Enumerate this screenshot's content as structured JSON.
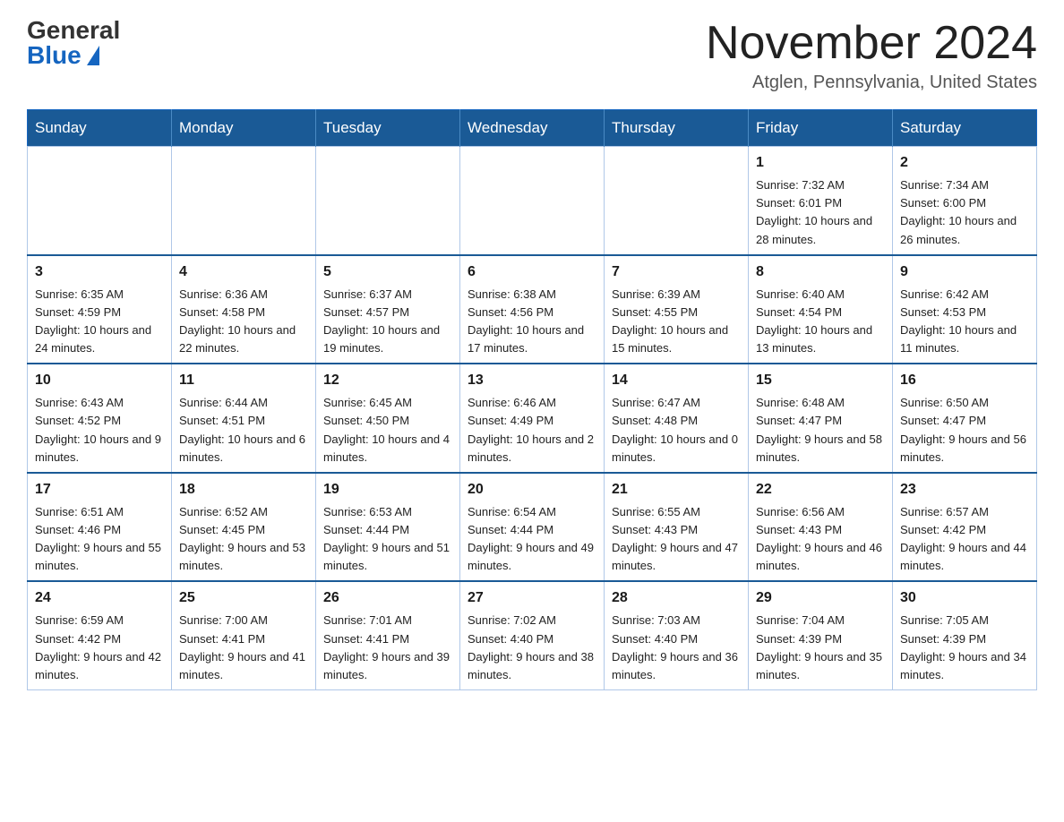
{
  "header": {
    "logo_general": "General",
    "logo_blue": "Blue",
    "month_title": "November 2024",
    "location": "Atglen, Pennsylvania, United States"
  },
  "days_of_week": [
    "Sunday",
    "Monday",
    "Tuesday",
    "Wednesday",
    "Thursday",
    "Friday",
    "Saturday"
  ],
  "weeks": [
    [
      {
        "day": "",
        "info": ""
      },
      {
        "day": "",
        "info": ""
      },
      {
        "day": "",
        "info": ""
      },
      {
        "day": "",
        "info": ""
      },
      {
        "day": "",
        "info": ""
      },
      {
        "day": "1",
        "info": "Sunrise: 7:32 AM\nSunset: 6:01 PM\nDaylight: 10 hours and 28 minutes."
      },
      {
        "day": "2",
        "info": "Sunrise: 7:34 AM\nSunset: 6:00 PM\nDaylight: 10 hours and 26 minutes."
      }
    ],
    [
      {
        "day": "3",
        "info": "Sunrise: 6:35 AM\nSunset: 4:59 PM\nDaylight: 10 hours and 24 minutes."
      },
      {
        "day": "4",
        "info": "Sunrise: 6:36 AM\nSunset: 4:58 PM\nDaylight: 10 hours and 22 minutes."
      },
      {
        "day": "5",
        "info": "Sunrise: 6:37 AM\nSunset: 4:57 PM\nDaylight: 10 hours and 19 minutes."
      },
      {
        "day": "6",
        "info": "Sunrise: 6:38 AM\nSunset: 4:56 PM\nDaylight: 10 hours and 17 minutes."
      },
      {
        "day": "7",
        "info": "Sunrise: 6:39 AM\nSunset: 4:55 PM\nDaylight: 10 hours and 15 minutes."
      },
      {
        "day": "8",
        "info": "Sunrise: 6:40 AM\nSunset: 4:54 PM\nDaylight: 10 hours and 13 minutes."
      },
      {
        "day": "9",
        "info": "Sunrise: 6:42 AM\nSunset: 4:53 PM\nDaylight: 10 hours and 11 minutes."
      }
    ],
    [
      {
        "day": "10",
        "info": "Sunrise: 6:43 AM\nSunset: 4:52 PM\nDaylight: 10 hours and 9 minutes."
      },
      {
        "day": "11",
        "info": "Sunrise: 6:44 AM\nSunset: 4:51 PM\nDaylight: 10 hours and 6 minutes."
      },
      {
        "day": "12",
        "info": "Sunrise: 6:45 AM\nSunset: 4:50 PM\nDaylight: 10 hours and 4 minutes."
      },
      {
        "day": "13",
        "info": "Sunrise: 6:46 AM\nSunset: 4:49 PM\nDaylight: 10 hours and 2 minutes."
      },
      {
        "day": "14",
        "info": "Sunrise: 6:47 AM\nSunset: 4:48 PM\nDaylight: 10 hours and 0 minutes."
      },
      {
        "day": "15",
        "info": "Sunrise: 6:48 AM\nSunset: 4:47 PM\nDaylight: 9 hours and 58 minutes."
      },
      {
        "day": "16",
        "info": "Sunrise: 6:50 AM\nSunset: 4:47 PM\nDaylight: 9 hours and 56 minutes."
      }
    ],
    [
      {
        "day": "17",
        "info": "Sunrise: 6:51 AM\nSunset: 4:46 PM\nDaylight: 9 hours and 55 minutes."
      },
      {
        "day": "18",
        "info": "Sunrise: 6:52 AM\nSunset: 4:45 PM\nDaylight: 9 hours and 53 minutes."
      },
      {
        "day": "19",
        "info": "Sunrise: 6:53 AM\nSunset: 4:44 PM\nDaylight: 9 hours and 51 minutes."
      },
      {
        "day": "20",
        "info": "Sunrise: 6:54 AM\nSunset: 4:44 PM\nDaylight: 9 hours and 49 minutes."
      },
      {
        "day": "21",
        "info": "Sunrise: 6:55 AM\nSunset: 4:43 PM\nDaylight: 9 hours and 47 minutes."
      },
      {
        "day": "22",
        "info": "Sunrise: 6:56 AM\nSunset: 4:43 PM\nDaylight: 9 hours and 46 minutes."
      },
      {
        "day": "23",
        "info": "Sunrise: 6:57 AM\nSunset: 4:42 PM\nDaylight: 9 hours and 44 minutes."
      }
    ],
    [
      {
        "day": "24",
        "info": "Sunrise: 6:59 AM\nSunset: 4:42 PM\nDaylight: 9 hours and 42 minutes."
      },
      {
        "day": "25",
        "info": "Sunrise: 7:00 AM\nSunset: 4:41 PM\nDaylight: 9 hours and 41 minutes."
      },
      {
        "day": "26",
        "info": "Sunrise: 7:01 AM\nSunset: 4:41 PM\nDaylight: 9 hours and 39 minutes."
      },
      {
        "day": "27",
        "info": "Sunrise: 7:02 AM\nSunset: 4:40 PM\nDaylight: 9 hours and 38 minutes."
      },
      {
        "day": "28",
        "info": "Sunrise: 7:03 AM\nSunset: 4:40 PM\nDaylight: 9 hours and 36 minutes."
      },
      {
        "day": "29",
        "info": "Sunrise: 7:04 AM\nSunset: 4:39 PM\nDaylight: 9 hours and 35 minutes."
      },
      {
        "day": "30",
        "info": "Sunrise: 7:05 AM\nSunset: 4:39 PM\nDaylight: 9 hours and 34 minutes."
      }
    ]
  ]
}
